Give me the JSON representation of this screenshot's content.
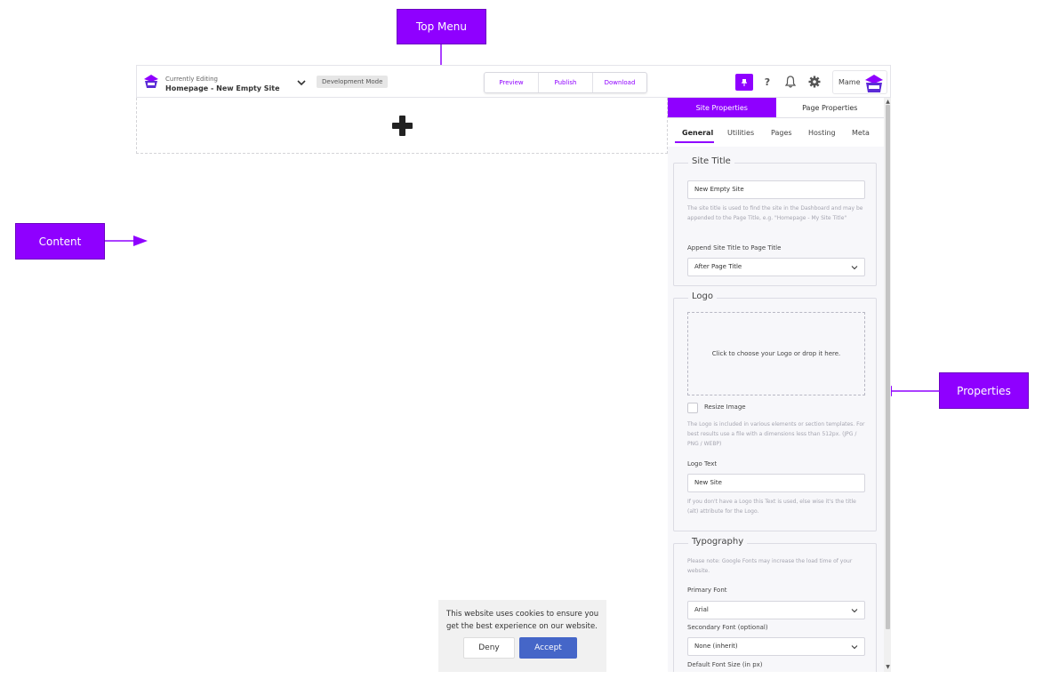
{
  "callouts": {
    "top_menu": "Top Menu",
    "content": "Content",
    "properties": "Properties"
  },
  "topbar": {
    "currently_editing_label": "Currently Editing",
    "page_name": "Homepage - New Empty Site",
    "mode_badge": "Development Mode",
    "actions": [
      "Preview",
      "Publish",
      "Download"
    ],
    "help_glyph": "?",
    "user_name": "Mame"
  },
  "panel": {
    "tabs": [
      "Site Properties",
      "Page Properties"
    ],
    "active_tab": "Site Properties",
    "subtabs": [
      "General",
      "Utilities",
      "Pages",
      "Hosting",
      "Meta"
    ],
    "active_subtab": "General",
    "site_title": {
      "legend": "Site Title",
      "value": "New Empty Site",
      "help": "The site title is used to find the site in the Dashboard and may be appended to the Page Title, e.g. \"Homepage - My Site Title\"",
      "append_label": "Append Site Title to Page Title",
      "append_value": "After Page Title"
    },
    "logo": {
      "legend": "Logo",
      "drop_text": "Click to choose your Logo or drop it here.",
      "resize_label": "Resize Image",
      "resize_checked": false,
      "help": "The Logo is included in various elements or section templates. For best results use a file with a dimensions less than 512px. (JPG / PNG / WEBP)",
      "text_label": "Logo Text",
      "text_value": "New Site",
      "text_help": "If you don't have a Logo this Text is used, else wise it's the title (alt) attribute for the Logo."
    },
    "typography": {
      "legend": "Typography",
      "note": "Please note: Google Fonts may increase the load time of your website.",
      "primary_label": "Primary Font",
      "primary_value": "Arial",
      "secondary_label": "Secondary Font (optional)",
      "secondary_value": "None (inherit)",
      "size_label": "Default Font Size (in px)"
    }
  },
  "cookie": {
    "message": "This website uses cookies to ensure you get the best experience on our website.",
    "deny": "Deny",
    "accept": "Accept"
  },
  "colors": {
    "accent": "#8f00ff",
    "accept_button": "#4566c8"
  },
  "icons": [
    "brand-logo-icon",
    "chevron-down-icon",
    "pin-icon",
    "help-icon",
    "bell-icon",
    "gear-icon",
    "avatar-icon",
    "plus-icon"
  ]
}
